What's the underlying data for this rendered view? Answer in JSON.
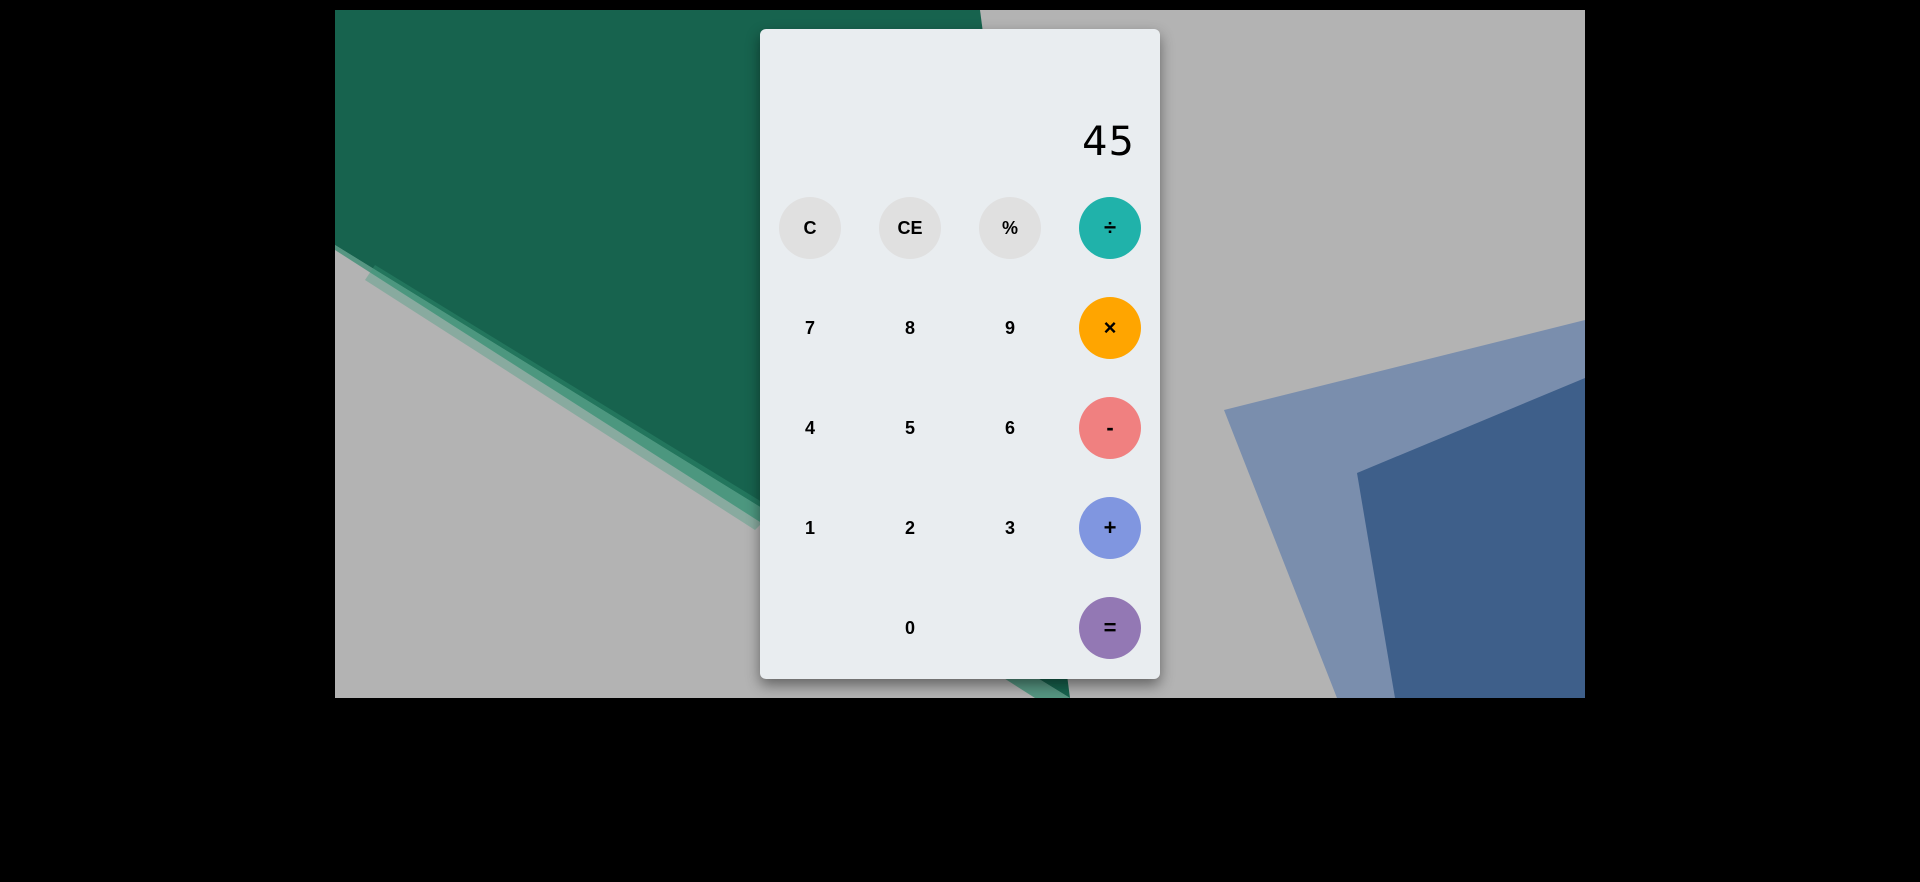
{
  "display": {
    "value": "45"
  },
  "buttons": {
    "clear": "C",
    "clear_entry": "CE",
    "percent": "%",
    "divide": "÷",
    "seven": "7",
    "eight": "8",
    "nine": "9",
    "multiply": "×",
    "four": "4",
    "five": "5",
    "six": "6",
    "subtract": "-",
    "one": "1",
    "two": "2",
    "three": "3",
    "add": "+",
    "zero": "0",
    "equals": "="
  },
  "colors": {
    "divide": "#20b2aa",
    "multiply": "#ffa500",
    "subtract": "#f08080",
    "add": "#8096e0",
    "equals": "#9378b4",
    "function_bg": "#e0e0e0",
    "panel_bg": "#e9edf0",
    "backdrop": "#b3b3b3",
    "green_shape": "#17634e",
    "blue_shape": "#3e5f8a"
  }
}
